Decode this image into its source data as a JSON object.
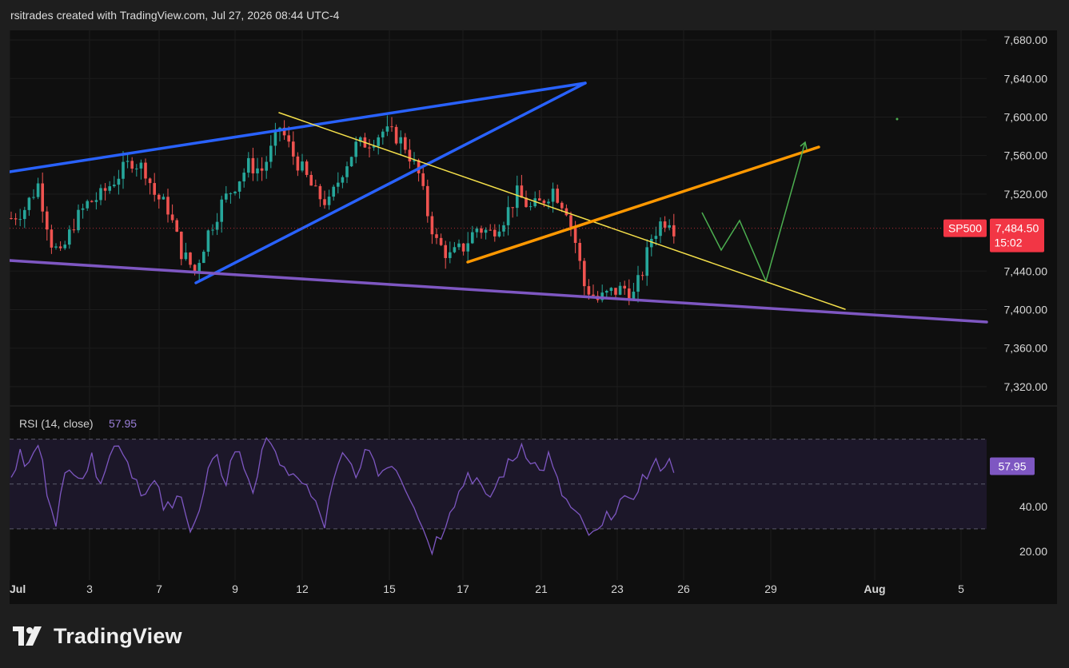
{
  "header": {
    "text": "rsitrades created with TradingView.com, Jul 27, 2026 08:44 UTC-4"
  },
  "footer": {
    "brand": "TradingView"
  },
  "colors": {
    "background": "#0f0f0f",
    "outer": "#1e1e1e",
    "candle_up": "#26a69a",
    "candle_down": "#ef5350",
    "blue_line": "#2962ff",
    "yellow_line": "#f5e04a",
    "orange_line": "#ff9800",
    "purple_line": "#7e57c2",
    "projection": "#4caf50",
    "rsi_line": "#7e57c2",
    "rsi_band": "#1c1729",
    "price_label": "#f23645"
  },
  "price_axis": {
    "ticks": [
      "7,680.00",
      "7,640.00",
      "7,600.00",
      "7,560.00",
      "7,520.00",
      "7,440.00",
      "7,400.00",
      "7,360.00",
      "7,320.00"
    ]
  },
  "price_label": {
    "symbol": "SP500",
    "price": "7,484.50",
    "countdown": "15:02"
  },
  "rsi": {
    "label": "RSI (14, close)",
    "value": "57.95",
    "ticks": [
      "40.00",
      "20.00"
    ],
    "upper": 70,
    "lower": 30,
    "middle": 50
  },
  "time_axis": {
    "labels": [
      "Jul",
      "3",
      "7",
      "9",
      "12",
      "15",
      "17",
      "21",
      "23",
      "26",
      "29",
      "Aug",
      "5"
    ]
  },
  "chart_data": {
    "type": "candlestick",
    "symbol": "SP500",
    "ylim": [
      7300,
      7690
    ],
    "rsi_ylim": [
      10,
      82
    ],
    "x_categories": [
      "Jul",
      "3",
      "7",
      "9",
      "12",
      "15",
      "17",
      "21",
      "23",
      "26",
      "29",
      "Aug",
      "5"
    ],
    "price_path": [
      [
        0,
        7495
      ],
      [
        3,
        7505
      ],
      [
        6,
        7530
      ],
      [
        9,
        7470
      ],
      [
        11,
        7455
      ],
      [
        14,
        7490
      ],
      [
        17,
        7510
      ],
      [
        20,
        7518
      ],
      [
        24,
        7540
      ],
      [
        27,
        7555
      ],
      [
        30,
        7545
      ],
      [
        32,
        7520
      ],
      [
        35,
        7505
      ],
      [
        38,
        7460
      ],
      [
        41,
        7440
      ],
      [
        44,
        7480
      ],
      [
        47,
        7510
      ],
      [
        50,
        7530
      ],
      [
        53,
        7550
      ],
      [
        56,
        7545
      ],
      [
        58,
        7565
      ],
      [
        60,
        7590
      ],
      [
        63,
        7560
      ],
      [
        65,
        7545
      ],
      [
        68,
        7520
      ],
      [
        71,
        7510
      ],
      [
        74,
        7545
      ],
      [
        77,
        7570
      ],
      [
        80,
        7575
      ],
      [
        83,
        7585
      ],
      [
        86,
        7580
      ],
      [
        88,
        7570
      ],
      [
        91,
        7540
      ],
      [
        93,
        7500
      ],
      [
        95,
        7470
      ],
      [
        98,
        7455
      ],
      [
        101,
        7465
      ],
      [
        104,
        7485
      ],
      [
        107,
        7480
      ],
      [
        110,
        7495
      ],
      [
        113,
        7520
      ],
      [
        116,
        7505
      ],
      [
        118,
        7510
      ],
      [
        121,
        7525
      ],
      [
        124,
        7505
      ],
      [
        126,
        7470
      ],
      [
        128,
        7425
      ],
      [
        131,
        7410
      ],
      [
        134,
        7418
      ],
      [
        137,
        7422
      ],
      [
        139,
        7415
      ],
      [
        141,
        7440
      ],
      [
        143,
        7475
      ],
      [
        145,
        7490
      ],
      [
        147,
        7495
      ],
      [
        148,
        7485
      ]
    ],
    "rsi_path": [
      [
        0,
        55
      ],
      [
        2,
        62
      ],
      [
        4,
        58
      ],
      [
        6,
        68
      ],
      [
        8,
        48
      ],
      [
        10,
        35
      ],
      [
        12,
        52
      ],
      [
        14,
        58
      ],
      [
        16,
        55
      ],
      [
        18,
        60
      ],
      [
        20,
        54
      ],
      [
        22,
        62
      ],
      [
        24,
        70
      ],
      [
        26,
        60
      ],
      [
        28,
        52
      ],
      [
        30,
        45
      ],
      [
        32,
        50
      ],
      [
        34,
        40
      ],
      [
        36,
        38
      ],
      [
        38,
        48
      ],
      [
        40,
        30
      ],
      [
        42,
        36
      ],
      [
        44,
        55
      ],
      [
        46,
        60
      ],
      [
        48,
        52
      ],
      [
        50,
        66
      ],
      [
        52,
        58
      ],
      [
        54,
        48
      ],
      [
        56,
        62
      ],
      [
        58,
        72
      ],
      [
        60,
        60
      ],
      [
        62,
        50
      ],
      [
        64,
        55
      ],
      [
        66,
        48
      ],
      [
        68,
        40
      ],
      [
        70,
        32
      ],
      [
        72,
        50
      ],
      [
        74,
        62
      ],
      [
        76,
        58
      ],
      [
        78,
        55
      ],
      [
        80,
        68
      ],
      [
        82,
        54
      ],
      [
        84,
        60
      ],
      [
        86,
        58
      ],
      [
        88,
        50
      ],
      [
        90,
        42
      ],
      [
        92,
        30
      ],
      [
        94,
        22
      ],
      [
        96,
        28
      ],
      [
        98,
        40
      ],
      [
        100,
        46
      ],
      [
        102,
        55
      ],
      [
        104,
        52
      ],
      [
        106,
        42
      ],
      [
        108,
        48
      ],
      [
        110,
        56
      ],
      [
        112,
        60
      ],
      [
        114,
        68
      ],
      [
        116,
        62
      ],
      [
        118,
        55
      ],
      [
        120,
        62
      ],
      [
        122,
        50
      ],
      [
        124,
        42
      ],
      [
        126,
        36
      ],
      [
        128,
        30
      ],
      [
        130,
        26
      ],
      [
        132,
        30
      ],
      [
        134,
        38
      ],
      [
        136,
        42
      ],
      [
        138,
        40
      ],
      [
        140,
        50
      ],
      [
        142,
        54
      ],
      [
        144,
        58
      ],
      [
        146,
        60
      ],
      [
        148,
        57.95
      ]
    ],
    "projection": [
      [
        148,
        7484.5
      ],
      [
        151,
        7460
      ],
      [
        154,
        7478
      ],
      [
        158,
        7420
      ],
      [
        162,
        7510
      ],
      [
        165,
        7563
      ]
    ]
  }
}
